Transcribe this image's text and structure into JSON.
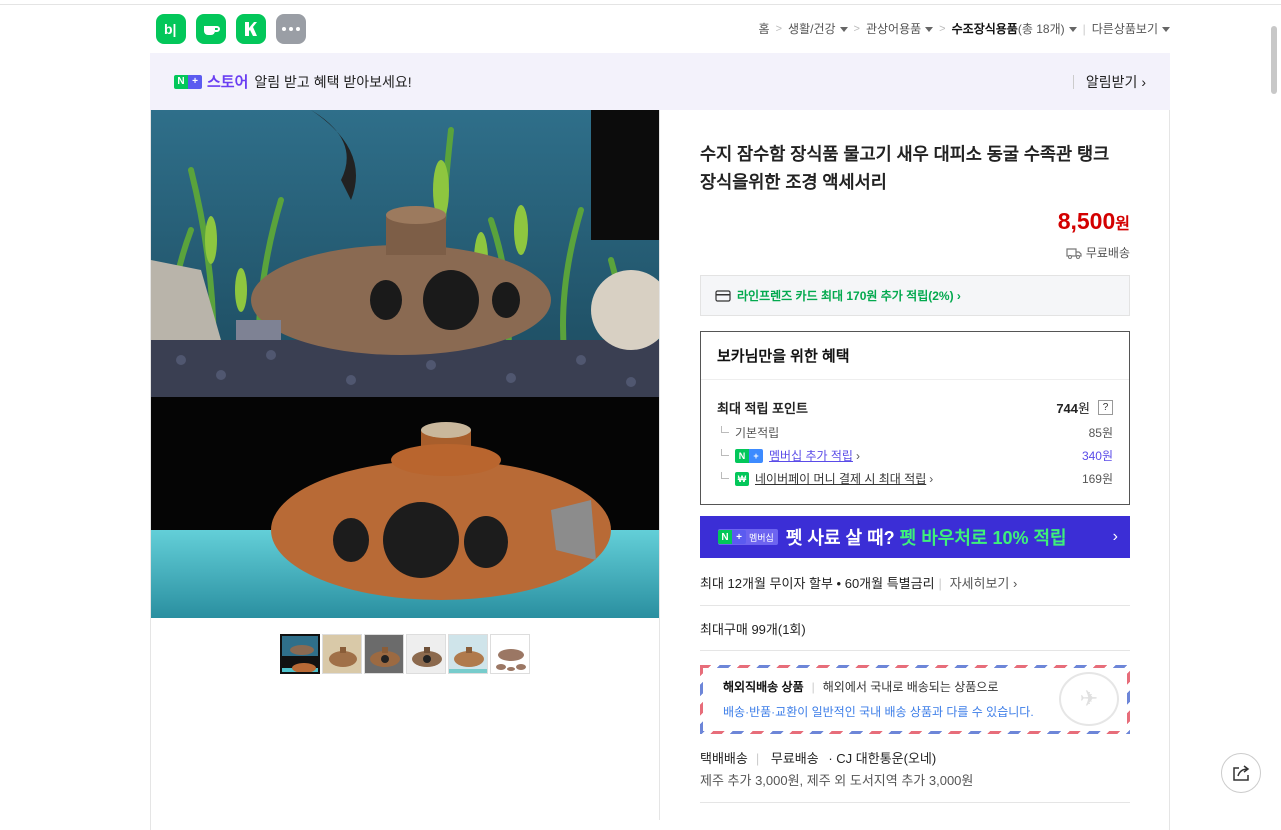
{
  "header": {
    "app_icons": [
      {
        "name": "band-app-icon",
        "glyph": "b|"
      },
      {
        "name": "cafe-app-icon",
        "glyph": "☕"
      },
      {
        "name": "naver-app-icon",
        "glyph": "K"
      },
      {
        "name": "more-apps-icon",
        "glyph": "•••"
      }
    ],
    "breadcrumb": {
      "home": "홈",
      "level1": "생활/건강",
      "level2": "관상어용품",
      "level3": "수조장식용품",
      "level3_count": "(총 18개)",
      "other": "다른상품보기"
    }
  },
  "alert_bar": {
    "store_label": "스토어",
    "message": "알림 받고 혜택 받아보세요!",
    "action": "알림받기 ›"
  },
  "product": {
    "title": "수지 잠수함 장식품 물고기 새우 대피소 동굴 수족관 탱크 장식을위한 조경 액세서리",
    "price": "8,500",
    "price_unit": "원",
    "shipping": "무료배송",
    "card_offer": "라인프렌즈 카드 최대 170원 추가 적립(2%) ›"
  },
  "benefits": {
    "title": "보카님만을 위한 혜택",
    "max_points_label": "최대 적립 포인트",
    "max_points_value": "744",
    "max_points_unit": "원",
    "help": "?",
    "basic_label": "기본적립",
    "basic_value": "85원",
    "membership_label": "멤버십 추가 적립",
    "membership_value": "340원",
    "naverpay_label": "네이버페이 머니 결제 시 최대 적립",
    "naverpay_value": "169원"
  },
  "promo_banner": {
    "badge": "멤버십",
    "text": "펫 사료 살 때?",
    "highlight": "펫 바우처로 10% 적립",
    "chevron": "›"
  },
  "installment": {
    "text": "최대 12개월 무이자 할부 • 60개월 특별금리",
    "more": "자세히보기 ›"
  },
  "max_purchase": "최대구매 99개(1회)",
  "overseas": {
    "label": "해외직배송 상품",
    "desc": "해외에서 국내로 배송되는 상품으로",
    "note": "배송·반품·교환이 일반적인 국내 배송 상품과 다를 수 있습니다."
  },
  "delivery": {
    "type": "택배배송",
    "fee": "무료배송",
    "courier": "· CJ 대한통운(오네)",
    "extra": "제주 추가 3,000원, 제주 외 도서지역 추가 3,000원"
  },
  "gallery": {
    "thumb_count": 6,
    "active_thumb": 0
  },
  "colors": {
    "brand_green": "#03c75a",
    "price_red": "#d30000",
    "membership_purple": "#3b2ed6"
  }
}
